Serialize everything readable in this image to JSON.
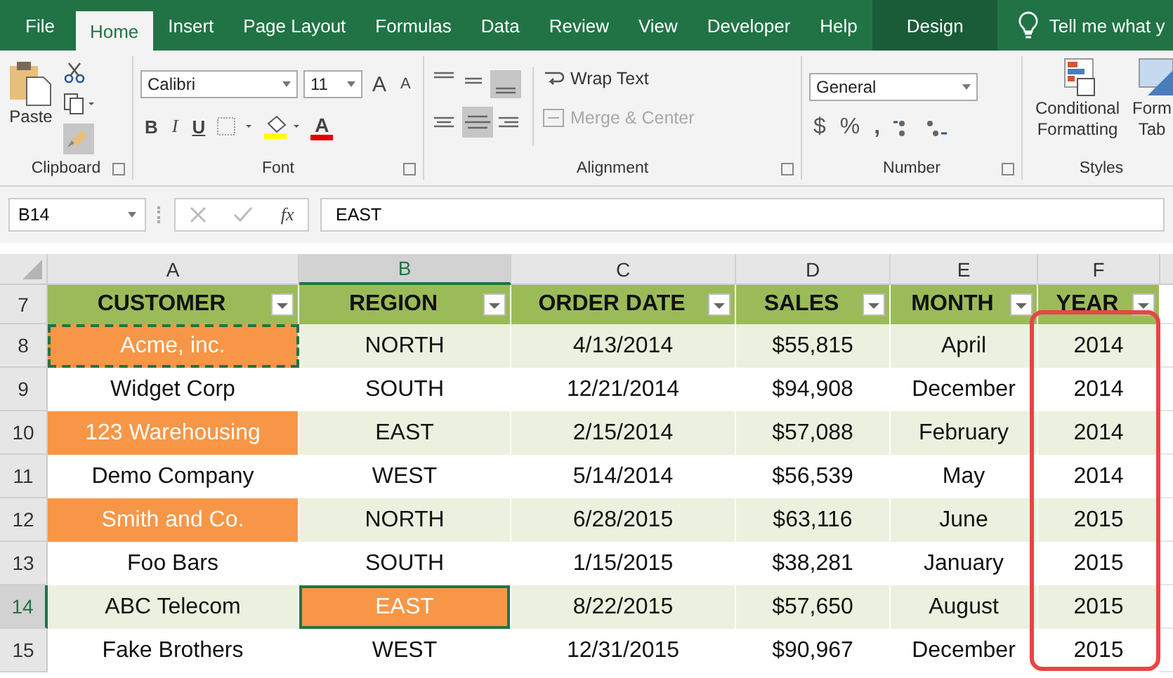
{
  "tabs": [
    {
      "label": "File",
      "selected": false,
      "kind": "normal"
    },
    {
      "label": "Home",
      "selected": true,
      "kind": "normal"
    },
    {
      "label": "Insert",
      "selected": false,
      "kind": "normal"
    },
    {
      "label": "Page Layout",
      "selected": false,
      "kind": "normal"
    },
    {
      "label": "Formulas",
      "selected": false,
      "kind": "normal"
    },
    {
      "label": "Data",
      "selected": false,
      "kind": "normal"
    },
    {
      "label": "Review",
      "selected": false,
      "kind": "normal"
    },
    {
      "label": "View",
      "selected": false,
      "kind": "normal"
    },
    {
      "label": "Developer",
      "selected": false,
      "kind": "normal"
    },
    {
      "label": "Help",
      "selected": false,
      "kind": "normal"
    },
    {
      "label": "Design",
      "selected": false,
      "kind": "contextual"
    }
  ],
  "tell_me": "Tell me what y",
  "ribbon": {
    "clipboard": {
      "label": "Clipboard",
      "paste": "Paste"
    },
    "font": {
      "label": "Font",
      "name": "Calibri",
      "size": "11",
      "grow": "A",
      "shrink": "A",
      "bold": "B",
      "italic": "I",
      "underline": "U",
      "font_color": "A"
    },
    "alignment": {
      "label": "Alignment",
      "wrap": "Wrap Text",
      "merge": "Merge & Center",
      "merge_disabled": true
    },
    "number": {
      "label": "Number",
      "format": "General",
      "currency": "$",
      "percent": "%",
      "comma": ","
    },
    "styles": {
      "label": "Styles",
      "conditional": "Conditional Formatting",
      "format_table": "Form Tab"
    }
  },
  "name_box": "B14",
  "fx": "fx",
  "formula": "EAST",
  "columns": [
    {
      "letter": "A",
      "selected": false
    },
    {
      "letter": "B",
      "selected": true
    },
    {
      "letter": "C",
      "selected": false
    },
    {
      "letter": "D",
      "selected": false
    },
    {
      "letter": "E",
      "selected": false
    },
    {
      "letter": "F",
      "selected": false
    }
  ],
  "header_row": {
    "number": "7",
    "headings": [
      "CUSTOMER",
      "REGION",
      "ORDER DATE",
      "SALES",
      "MONTH",
      "YEAR"
    ]
  },
  "rows": [
    {
      "number": "8",
      "selected": false,
      "cells": [
        {
          "text": "Acme, inc.",
          "fill": true,
          "selected": false,
          "marquee": true
        },
        {
          "text": "NORTH",
          "fill": false,
          "selected": false,
          "marquee": false
        },
        {
          "text": "4/13/2014",
          "fill": false,
          "selected": false,
          "marquee": false
        },
        {
          "text": "$55,815",
          "fill": false,
          "selected": false,
          "marquee": false
        },
        {
          "text": "April",
          "fill": false,
          "selected": false,
          "marquee": false
        },
        {
          "text": "2014",
          "fill": false,
          "selected": false,
          "marquee": false
        }
      ]
    },
    {
      "number": "9",
      "selected": false,
      "cells": [
        {
          "text": "Widget Corp",
          "fill": false,
          "selected": false,
          "marquee": false
        },
        {
          "text": "SOUTH",
          "fill": false,
          "selected": false,
          "marquee": false
        },
        {
          "text": "12/21/2014",
          "fill": false,
          "selected": false,
          "marquee": false
        },
        {
          "text": "$94,908",
          "fill": false,
          "selected": false,
          "marquee": false
        },
        {
          "text": "December",
          "fill": false,
          "selected": false,
          "marquee": false
        },
        {
          "text": "2014",
          "fill": false,
          "selected": false,
          "marquee": false
        }
      ]
    },
    {
      "number": "10",
      "selected": false,
      "cells": [
        {
          "text": "123 Warehousing",
          "fill": true,
          "selected": false,
          "marquee": false
        },
        {
          "text": "EAST",
          "fill": false,
          "selected": false,
          "marquee": false
        },
        {
          "text": "2/15/2014",
          "fill": false,
          "selected": false,
          "marquee": false
        },
        {
          "text": "$57,088",
          "fill": false,
          "selected": false,
          "marquee": false
        },
        {
          "text": "February",
          "fill": false,
          "selected": false,
          "marquee": false
        },
        {
          "text": "2014",
          "fill": false,
          "selected": false,
          "marquee": false
        }
      ]
    },
    {
      "number": "11",
      "selected": false,
      "cells": [
        {
          "text": "Demo Company",
          "fill": false,
          "selected": false,
          "marquee": false
        },
        {
          "text": "WEST",
          "fill": false,
          "selected": false,
          "marquee": false
        },
        {
          "text": "5/14/2014",
          "fill": false,
          "selected": false,
          "marquee": false
        },
        {
          "text": "$56,539",
          "fill": false,
          "selected": false,
          "marquee": false
        },
        {
          "text": "May",
          "fill": false,
          "selected": false,
          "marquee": false
        },
        {
          "text": "2014",
          "fill": false,
          "selected": false,
          "marquee": false
        }
      ]
    },
    {
      "number": "12",
      "selected": false,
      "cells": [
        {
          "text": "Smith and Co.",
          "fill": true,
          "selected": false,
          "marquee": false
        },
        {
          "text": "NORTH",
          "fill": false,
          "selected": false,
          "marquee": false
        },
        {
          "text": "6/28/2015",
          "fill": false,
          "selected": false,
          "marquee": false
        },
        {
          "text": "$63,116",
          "fill": false,
          "selected": false,
          "marquee": false
        },
        {
          "text": "June",
          "fill": false,
          "selected": false,
          "marquee": false
        },
        {
          "text": "2015",
          "fill": false,
          "selected": false,
          "marquee": false
        }
      ]
    },
    {
      "number": "13",
      "selected": false,
      "cells": [
        {
          "text": "Foo Bars",
          "fill": false,
          "selected": false,
          "marquee": false
        },
        {
          "text": "SOUTH",
          "fill": false,
          "selected": false,
          "marquee": false
        },
        {
          "text": "1/15/2015",
          "fill": false,
          "selected": false,
          "marquee": false
        },
        {
          "text": "$38,281",
          "fill": false,
          "selected": false,
          "marquee": false
        },
        {
          "text": "January",
          "fill": false,
          "selected": false,
          "marquee": false
        },
        {
          "text": "2015",
          "fill": false,
          "selected": false,
          "marquee": false
        }
      ]
    },
    {
      "number": "14",
      "selected": true,
      "cells": [
        {
          "text": "ABC Telecom",
          "fill": false,
          "selected": false,
          "marquee": false
        },
        {
          "text": "EAST",
          "fill": true,
          "selected": true,
          "marquee": false
        },
        {
          "text": "8/22/2015",
          "fill": false,
          "selected": false,
          "marquee": false
        },
        {
          "text": "$57,650",
          "fill": false,
          "selected": false,
          "marquee": false
        },
        {
          "text": "August",
          "fill": false,
          "selected": false,
          "marquee": false
        },
        {
          "text": "2015",
          "fill": false,
          "selected": false,
          "marquee": false
        }
      ]
    },
    {
      "number": "15",
      "selected": false,
      "cells": [
        {
          "text": "Fake Brothers",
          "fill": false,
          "selected": false,
          "marquee": false
        },
        {
          "text": "WEST",
          "fill": false,
          "selected": false,
          "marquee": false
        },
        {
          "text": "12/31/2015",
          "fill": false,
          "selected": false,
          "marquee": false
        },
        {
          "text": "$90,967",
          "fill": false,
          "selected": false,
          "marquee": false
        },
        {
          "text": "December",
          "fill": false,
          "selected": false,
          "marquee": false
        },
        {
          "text": "2015",
          "fill": false,
          "selected": false,
          "marquee": false
        }
      ]
    }
  ]
}
